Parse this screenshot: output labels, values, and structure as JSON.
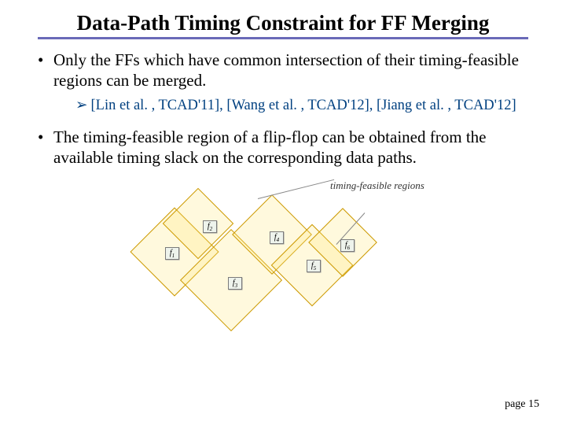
{
  "title": "Data-Path Timing Constraint for FF Merging",
  "bullets": {
    "b1": "Only the FFs which have common intersection of their timing-feasible regions can be merged.",
    "refs": "[Lin et al. , TCAD'11], [Wang et al. , TCAD'12], [Jiang et al. , TCAD'12]",
    "b2": "The timing-feasible region of a flip-flop can be obtained from the available timing slack on the corresponding data paths."
  },
  "figure": {
    "callout": "timing-feasible regions",
    "ff": {
      "f1": "f",
      "f2": "f",
      "f3": "f",
      "f4": "f",
      "f5": "f",
      "f6": "f"
    }
  },
  "page": "page 15"
}
